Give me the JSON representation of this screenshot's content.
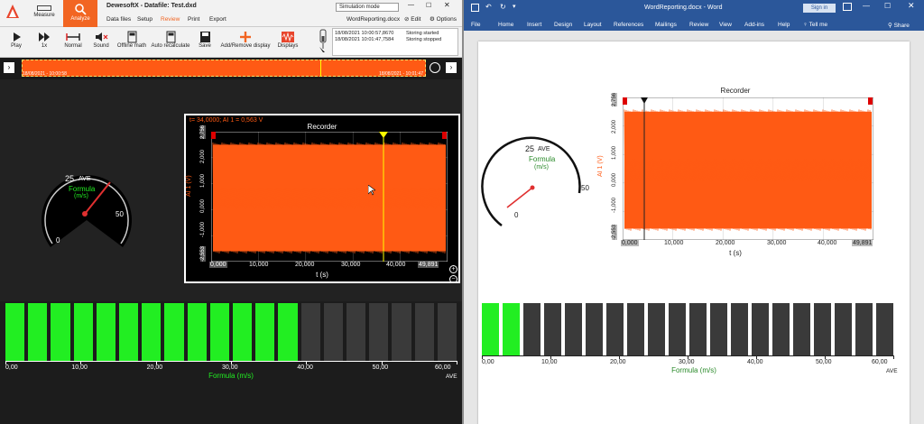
{
  "dewesoft": {
    "title": "DewesoftX - Datafile: Test.dxd",
    "tabs": {
      "measure": "Measure",
      "analyze": "Analyze"
    },
    "subtabs": [
      "Data files",
      "Setup",
      "Review",
      "Print",
      "Export"
    ],
    "sim_mode": "Simulation mode",
    "doc_label": "WordReporting.docx",
    "edit": "Edit",
    "options": "Options",
    "toolbar": {
      "play": "Play",
      "speed": "1x",
      "normal": "Normal",
      "sound": "Sound",
      "offline_math": "Offline math",
      "auto_recalc": "Auto recalculate",
      "save": "Save",
      "add_remove": "Add/Remove display",
      "displays": "Displays"
    },
    "log": [
      {
        "time": "18/08/2021 10:00:57,8670",
        "msg": "Storing started"
      },
      {
        "time": "18/08/2021 10:01:47,7584",
        "msg": "Storing stopped"
      }
    ],
    "timeline": {
      "left": "18/08/2021 - 10:00:58",
      "right": "18/08/2021 - 10:01:47"
    },
    "cursor_info": "t= 34,0000; AI 1 = 0,563 V",
    "recorder": {
      "title": "Recorder",
      "ylabel": "AI 1 (V)",
      "yticks": [
        "2,756",
        "2,000",
        "1,000",
        "0,000",
        "-1,000",
        "-2,553"
      ],
      "xstart": "0,000",
      "xticks": [
        "10,000",
        "20,000",
        "30,000",
        "40,000"
      ],
      "xend": "49,891",
      "xlabel": "t (s)"
    },
    "gauge": {
      "value": "25",
      "stat": "AVE",
      "name": "Formula",
      "unit": "(m/s)",
      "min": "0",
      "max": "50"
    },
    "bars": {
      "lit": 13,
      "total": 20,
      "ticks": [
        "0,00",
        "10,00",
        "20,00",
        "30,00",
        "40,00",
        "50,00",
        "60,00"
      ],
      "label": "Formula",
      "unit": "(m/s)",
      "stat": "AVE"
    }
  },
  "word": {
    "title": "WordReporting.docx - Word",
    "signin": "Sign in",
    "share": "Share",
    "tellme": "Tell me",
    "ribbon": [
      "File",
      "Home",
      "Insert",
      "Design",
      "Layout",
      "References",
      "Mailings",
      "Review",
      "View",
      "Add-ins",
      "Help"
    ],
    "recorder": {
      "title": "Recorder",
      "ylabel": "AI 1 (V)",
      "yticks": [
        "2,756",
        "2,000",
        "1,000",
        "0,000",
        "-1,000",
        "-2,553"
      ],
      "xstart": "0,000",
      "xticks": [
        "10,000",
        "20,000",
        "30,000",
        "40,000"
      ],
      "xend": "49,891",
      "xlabel": "t (s)"
    },
    "gauge": {
      "value": "25",
      "stat": "AVE",
      "name": "Formula",
      "unit": "(m/s)",
      "min": "0",
      "max": "50"
    },
    "bars": {
      "lit": 2,
      "total": 20,
      "ticks": [
        "0,00",
        "10,00",
        "20,00",
        "30,00",
        "40,00",
        "50,00",
        "60,00"
      ],
      "label": "Formula",
      "unit": "(m/s)",
      "stat": "AVE"
    }
  },
  "colors": {
    "accent": "#f26522",
    "signal": "#ff5a14",
    "bar_on": "#22ee22",
    "bar_off": "#3a3a3a",
    "word_blue": "#2b579a"
  }
}
